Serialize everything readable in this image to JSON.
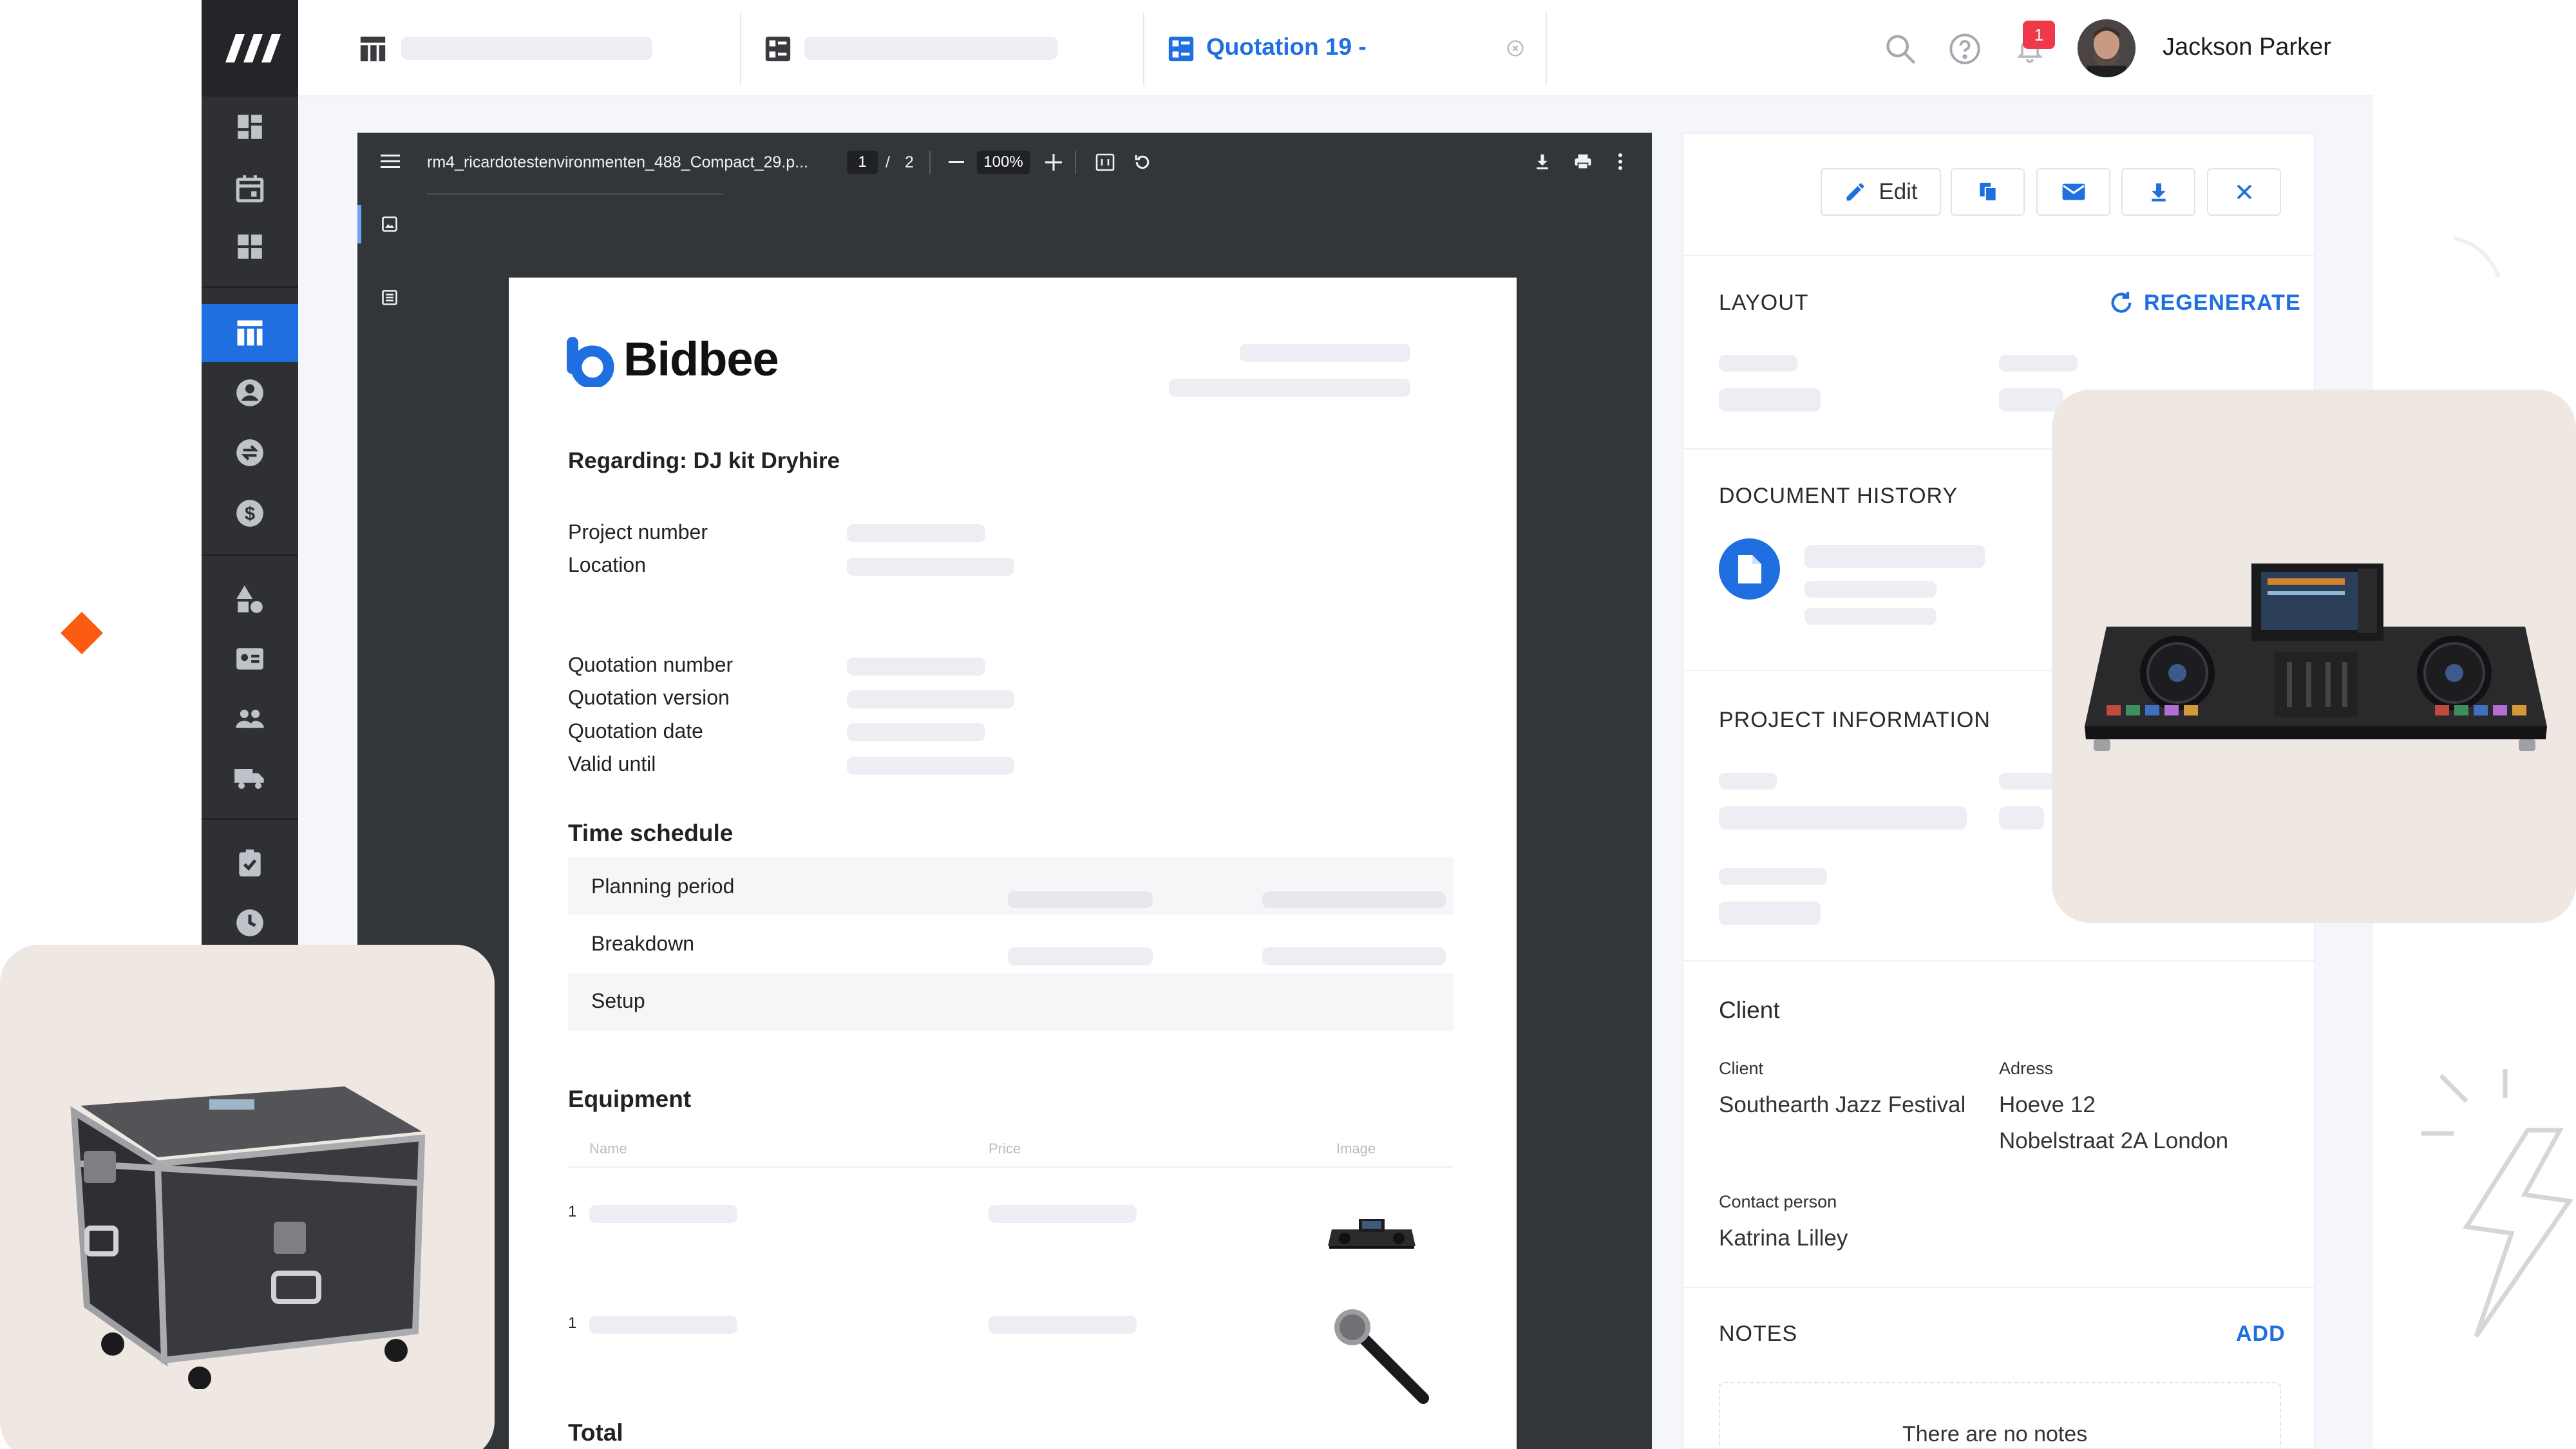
{
  "app": {
    "logo_alt": "brand-logo"
  },
  "topbar": {
    "tab_active": "Quotation 19 -",
    "notification_count": "1",
    "user_name": "Jackson Parker"
  },
  "viewer": {
    "filename": "rm4_ricardotestenvironmenten_488_Compact_29.p...",
    "page_current": "1",
    "page_sep": "/",
    "page_total": "2",
    "zoom": "100%"
  },
  "document": {
    "brand": "Bidbee",
    "regarding": "Regarding: DJ kit Dryhire",
    "fields_project": [
      "Project number",
      "Location"
    ],
    "fields_quotation": [
      "Quotation number",
      "Quotation version",
      "Quotation date",
      "Valid until"
    ],
    "time_schedule_title": "Time schedule",
    "time_schedule_rows": [
      "Planning period",
      "Breakdown",
      "Setup"
    ],
    "equipment_title": "Equipment",
    "equipment_columns": [
      "Name",
      "Price",
      "Image"
    ],
    "equipment_rows": [
      {
        "qty": "1"
      },
      {
        "qty": "1"
      }
    ],
    "total_label": "Total"
  },
  "panel": {
    "edit_label": "Edit",
    "layout_title": "LAYOUT",
    "regenerate_label": "REGENERATE",
    "history_title": "DOCUMENT HISTORY",
    "project_info_title": "PROJECT INFORMATION",
    "client_title": "Client",
    "client_label": "Client",
    "client_value": "Southearth Jazz Festival",
    "address_label": "Adress",
    "address_line1": "Hoeve 12",
    "address_line2": "Nobelstraat 2A London",
    "contact_label": "Contact person",
    "contact_value": "Katrina Lilley",
    "notes_title": "NOTES",
    "notes_add": "ADD",
    "notes_empty": "There are no notes"
  },
  "colors": {
    "accent": "#1f6fe0",
    "sidebar": "#2f3033",
    "badge": "#f0384a",
    "diamond": "#fb5c14",
    "card": "#efe8e2"
  }
}
